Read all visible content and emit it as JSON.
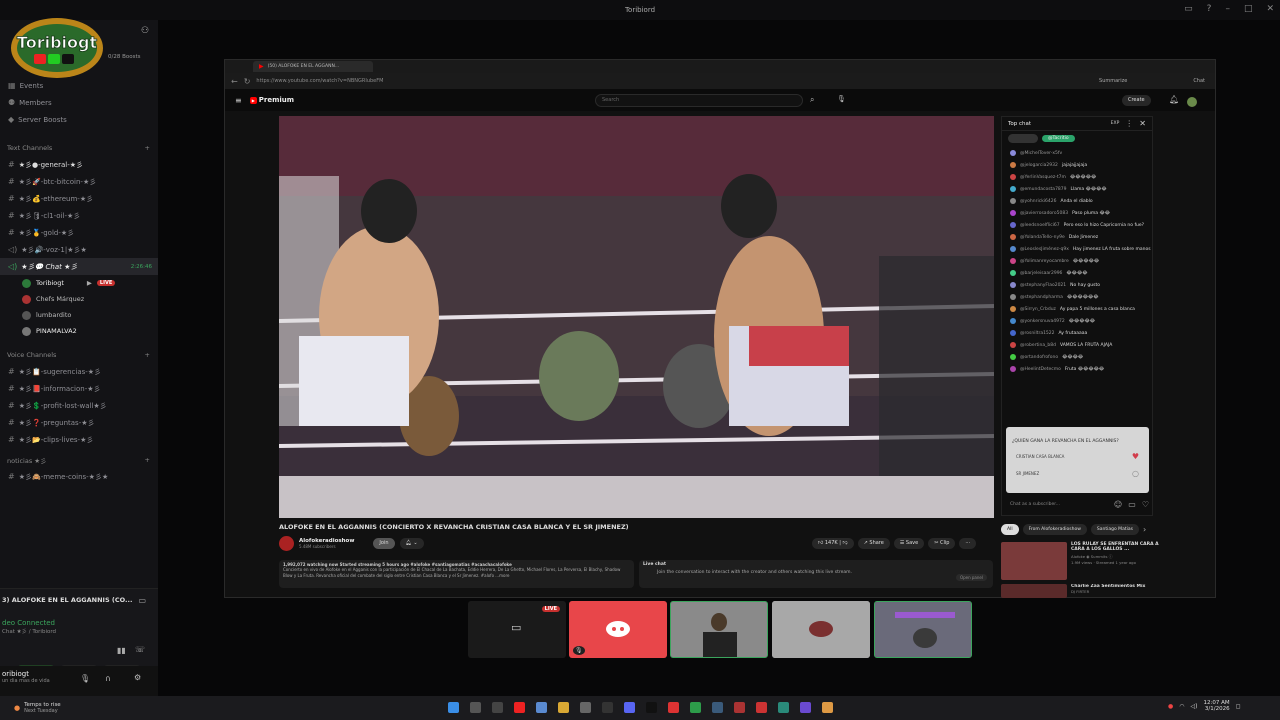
{
  "window": {
    "title": "Toribiord"
  },
  "sidebar": {
    "server_logo_text": "Toribiogt",
    "boosts": "0/28 Boosts",
    "menu": [
      "Events",
      "Members",
      "Server Boosts"
    ],
    "text_channels_label": "Text Channels",
    "text_channels": [
      "★彡●-general-★彡",
      "★彡🚀-btc-bitcoin-★彡",
      "★彡💰-ethereum-★彡",
      "★彡🛢-cl1-oil-★彡",
      "★彡🥇-gold-★彡",
      "★彡🔊-voz-1|★彡★",
      "★彡💬 Chat ★彡"
    ],
    "chat_time": "2:26:46",
    "voice_users": [
      {
        "name": "Toribiogt",
        "live": "LIVE"
      },
      {
        "name": "Chefs Márquez",
        "live": ""
      },
      {
        "name": "lumbardito",
        "live": ""
      },
      {
        "name": "PINAMALVA2",
        "live": ""
      }
    ],
    "voice_channels_label": "Voice Channels",
    "voice_channels": [
      "★彡📋-sugerencias-★彡",
      "★彡📕-informacion-★彡",
      "★彡💲-profit-lost-wall★彡",
      "★彡❓-preguntas-★彡",
      "★彡📂-clips-lives-★彡"
    ],
    "noticias_label": "noticias ★彡",
    "noticias_channels": [
      "★彡🙈-meme-coins-★彡★"
    ],
    "stream_title": "3) ALOFOKE EN EL AGGANNIS (CO...",
    "voice_connected": "deo Connected",
    "voice_location": "Chat ★彡 / Toribiord",
    "user_name": "oribiogt",
    "user_status": "un dia mas de vida"
  },
  "browser": {
    "tab_title": "(50) ALOFOKE EN EL AGGANN...",
    "url": "https://www.youtube.com/watch?v=NBNGRIubeFM",
    "summarize": "Summarize",
    "chat_btn": "Chat"
  },
  "youtube": {
    "logo": "Premium",
    "search_placeholder": "Search",
    "create": "Create",
    "video_title": "ALOFOKE EN EL AGGANNIS (CONCIERTO X REVANCHA CRISTIAN CASA BLANCA Y EL SR JIMENEZ)",
    "channel_name": "Alofokeradioshow",
    "subscribers": "5.48M subscribers",
    "join": "Join",
    "likes": "147K",
    "share": "Share",
    "save": "Save",
    "clip": "Clip",
    "watching": "1,992,072 watching now  Started streaming 5 hours ago  #alofoke #santiagomatias #acaachacalofoke",
    "description": "Concierto en vivo de Alofoke en el Agganis con la participación de El Chacal de La Bachata, Eddie Herrera, De La Ghetto, Michael Flores, La Perversa, El Blachy, Shadow Blow y La Fruta. Revancha oficial del combate del siglo entre Cristian Casa Blanca y el Sr Jimenez. #alofo ...more",
    "live_chat_label": "Live chat",
    "live_chat_text": "Join the conversation to interact with the creator and others watching this live stream.",
    "open_panel": "Open panel",
    "chat": {
      "header": "Top chat",
      "badge": "EXP",
      "pinned": "@Tacritio",
      "messages": [
        {
          "user": "@MichelTover-x5fv",
          "text": "",
          "color": "#8a8adb"
        },
        {
          "user": "@jelogarcia2932",
          "text": "jajajajjajaja",
          "color": "#cc7a44"
        },
        {
          "user": "@YerlinVasquez-t7m",
          "text": "😂😂😂😂😂",
          "color": "#cc4444"
        },
        {
          "user": "@emundacosta7879",
          "text": "Llama 😂😂😂😂",
          "color": "#44aacc"
        },
        {
          "user": "@yohnricki6426",
          "text": "Anda el diablo",
          "color": "#888888"
        },
        {
          "user": "@javierrosadoro5083",
          "text": "Paso pluma 😂😂",
          "color": "#aa44cc"
        },
        {
          "user": "@leedsnoelflici67",
          "text": "Pero eso lo hizo Capricornia no fue?",
          "color": "#6666cc"
        },
        {
          "user": "@YolandaTello-ny9e",
          "text": "Dale Jimenez",
          "color": "#cc6644"
        },
        {
          "user": "@LeoslesJiménez-q9x",
          "text": "Hay jimenez LA fruta sobre manos",
          "color": "#5588cc"
        },
        {
          "user": "@Yolimanreyocambre",
          "text": "😂😂😂😂😂",
          "color": "#cc4488"
        },
        {
          "user": "@barjeleisaar2996",
          "text": "😂😂😂😂",
          "color": "#44cc88"
        },
        {
          "user": "@stephanyFlao2021",
          "text": "No hay gusto",
          "color": "#8888cc"
        },
        {
          "user": "@stephandpharma",
          "text": "😂😂😂😂😂😂",
          "color": "#888888"
        },
        {
          "user": "@Sirryn_Crbduz",
          "text": "Ay papa 5 millones a casa blanca",
          "color": "#cc8844"
        },
        {
          "user": "@yonkersnuva4972",
          "text": "😂😂😂😂😂",
          "color": "#4488cc"
        },
        {
          "user": "@rosniltra1522",
          "text": "Ay frutaaaaa",
          "color": "#4466cc"
        },
        {
          "user": "@robertina_b8d",
          "text": "VAMOS LA FRUTA AJAJA",
          "color": "#cc4444"
        },
        {
          "user": "@ortandofrofono",
          "text": "😂😂😂😂",
          "color": "#44cc44"
        },
        {
          "user": "@HeelintDetecmo",
          "text": "Fruta 😂😂😂😂😂",
          "color": "#aa44aa"
        }
      ],
      "poll_question": "¿QUIEN GANA LA REVANCHA EN EL AGGANNIS?",
      "poll_options": [
        "CRISTIAN CASA BLANCA",
        "SR JIMENEZ"
      ],
      "input_placeholder": "Chat as a subscriber..."
    },
    "chips": [
      "All",
      "From Alofokeradioshow",
      "Santiago Matias"
    ],
    "recommendations": [
      {
        "title": "LOS RULAY SE ENFRENTAN CARA A CARA A LOS GALLOS ...",
        "channel": "Alofoke ◉ Summits ⓘ",
        "meta": "1.9M views · Streamed 1 year ago"
      },
      {
        "title": "Charlie Zaa Sentimientos Mix",
        "channel": "DJ FIRTER",
        "meta": ""
      }
    ]
  },
  "tiles": {
    "live": "LIVE"
  },
  "taskbar": {
    "weather_title": "Temps to rise",
    "weather_sub": "Next Tuesday",
    "time": "12:07 AM",
    "date": "3/1/2026"
  },
  "colors": {
    "discord_blurple": "#5865f2",
    "youtube_red": "#ff0000",
    "live_red": "#c8312f",
    "discord_tile": "#e8464a"
  }
}
